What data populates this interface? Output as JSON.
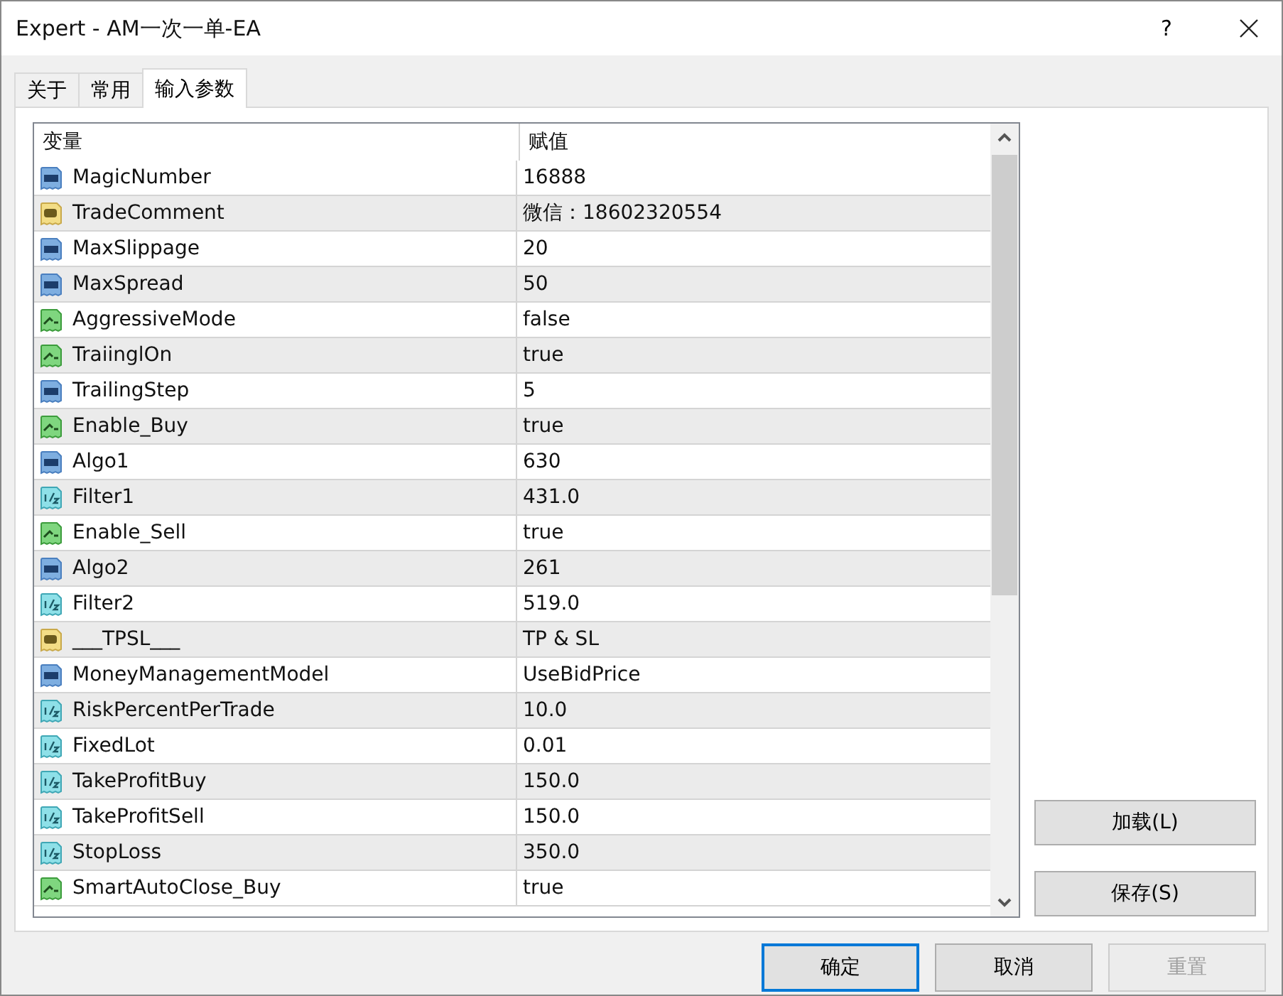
{
  "window": {
    "title": "Expert - AM一次一单-EA",
    "help": "?"
  },
  "tabs": [
    {
      "label": "关于",
      "selected": false
    },
    {
      "label": "常用",
      "selected": false
    },
    {
      "label": "输入参数",
      "selected": true
    }
  ],
  "table": {
    "columns": [
      "变量",
      "赋值"
    ],
    "rows": [
      {
        "kind": "int",
        "name": "MagicNumber",
        "value": "16888"
      },
      {
        "kind": "string",
        "name": "TradeComment",
        "value": "微信：18602320554"
      },
      {
        "kind": "int",
        "name": "MaxSlippage",
        "value": "20"
      },
      {
        "kind": "int",
        "name": "MaxSpread",
        "value": "50"
      },
      {
        "kind": "bool",
        "name": "AggressiveMode",
        "value": "false"
      },
      {
        "kind": "bool",
        "name": "TraiinglOn",
        "value": "true"
      },
      {
        "kind": "int",
        "name": "TrailingStep",
        "value": "5"
      },
      {
        "kind": "bool",
        "name": "Enable_Buy",
        "value": "true"
      },
      {
        "kind": "int",
        "name": "Algo1",
        "value": "630"
      },
      {
        "kind": "double",
        "name": "Filter1",
        "value": "431.0"
      },
      {
        "kind": "bool",
        "name": "Enable_Sell",
        "value": "true"
      },
      {
        "kind": "int",
        "name": "Algo2",
        "value": "261"
      },
      {
        "kind": "double",
        "name": "Filter2",
        "value": "519.0"
      },
      {
        "kind": "string",
        "name": "___TPSL___",
        "value": "TP & SL"
      },
      {
        "kind": "int",
        "name": "MoneyManagementModel",
        "value": "UseBidPrice"
      },
      {
        "kind": "double",
        "name": "RiskPercentPerTrade",
        "value": "10.0"
      },
      {
        "kind": "double",
        "name": "FixedLot",
        "value": "0.01"
      },
      {
        "kind": "double",
        "name": "TakeProfitBuy",
        "value": "150.0"
      },
      {
        "kind": "double",
        "name": "TakeProfitSell",
        "value": "150.0"
      },
      {
        "kind": "double",
        "name": "StopLoss",
        "value": "350.0"
      },
      {
        "kind": "bool",
        "name": "SmartAutoClose_Buy",
        "value": "true"
      }
    ]
  },
  "side_buttons": [
    "加载(L)",
    "保存(S)"
  ],
  "buttons": [
    {
      "label": "确定",
      "default": true,
      "disabled": false
    },
    {
      "label": "取消",
      "default": false,
      "disabled": false
    },
    {
      "label": "重置",
      "default": false,
      "disabled": true
    }
  ]
}
